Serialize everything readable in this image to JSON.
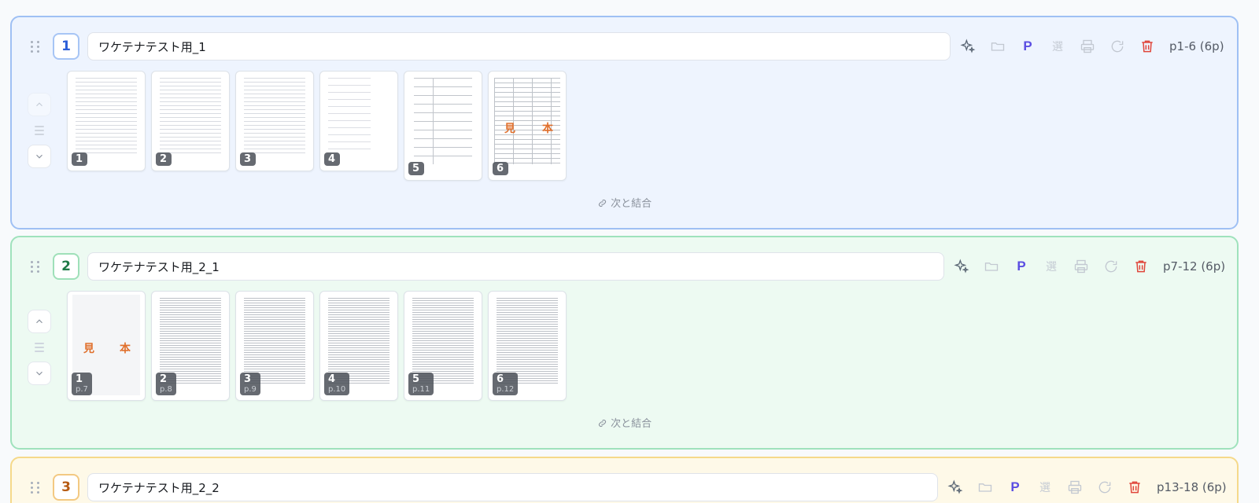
{
  "merge_label": "次と結合",
  "tool_labels": {
    "sparkle": "sparkle-icon",
    "folder": "folder-icon",
    "p": "P",
    "kanji": "選",
    "print": "print-icon",
    "refresh": "refresh-icon",
    "delete": "trash-icon"
  },
  "groups": [
    {
      "number": "1",
      "title": "ワケテナテスト用_1",
      "range": "p1-6 (6p)",
      "pages": [
        {
          "label": "1",
          "sub": ""
        },
        {
          "label": "2",
          "sub": ""
        },
        {
          "label": "3",
          "sub": ""
        },
        {
          "label": "4",
          "sub": ""
        },
        {
          "label": "5",
          "sub": ""
        },
        {
          "label": "6",
          "sub": ""
        }
      ],
      "stamp": [
        "見",
        "本"
      ]
    },
    {
      "number": "2",
      "title": "ワケテナテスト用_2_1",
      "range": "p7-12 (6p)",
      "pages": [
        {
          "label": "1",
          "sub": "p.7"
        },
        {
          "label": "2",
          "sub": "p.8"
        },
        {
          "label": "3",
          "sub": "p.9"
        },
        {
          "label": "4",
          "sub": "p.10"
        },
        {
          "label": "5",
          "sub": "p.11"
        },
        {
          "label": "6",
          "sub": "p.12"
        }
      ],
      "stamp": [
        "見",
        "本"
      ]
    },
    {
      "number": "3",
      "title": "ワケテナテスト用_2_2",
      "range": "p13-18 (6p)"
    }
  ],
  "colors": {
    "group1_border": "#9fc0f4",
    "group2_border": "#9fe2bc",
    "group3_border": "#f5d98a",
    "p_button": "#5b4ee2",
    "delete": "#e0453a"
  }
}
